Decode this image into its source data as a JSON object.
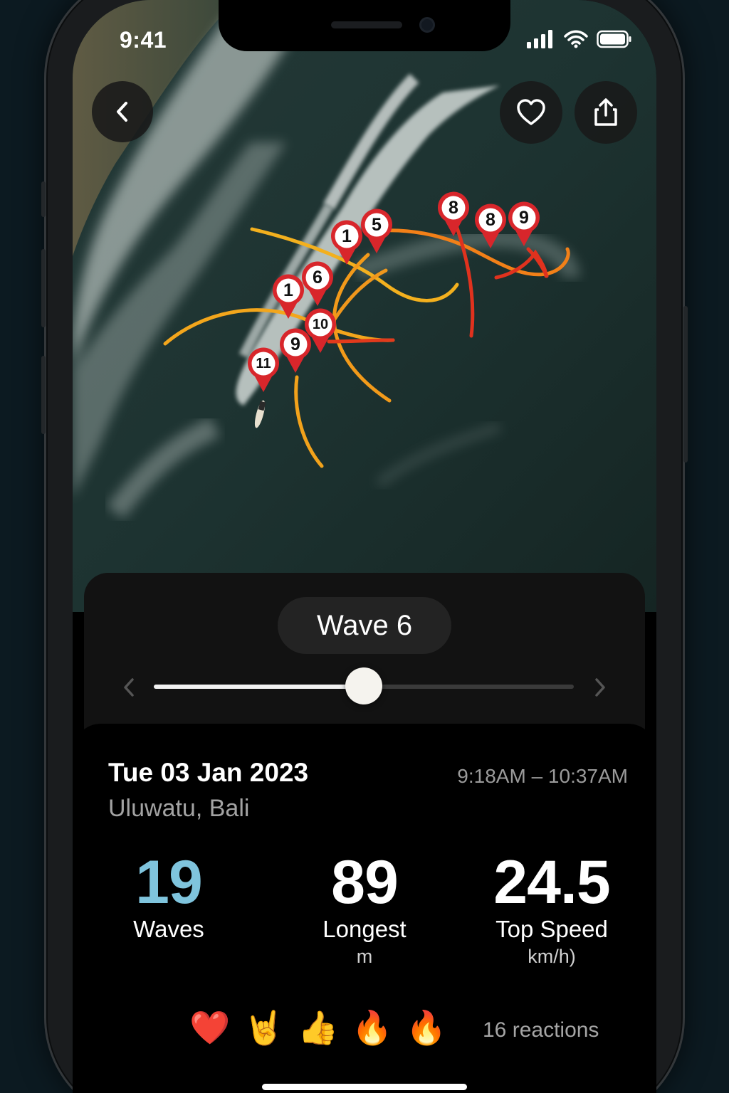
{
  "status_bar": {
    "time": "9:41"
  },
  "nav": {
    "back_icon": "chevron-left-icon",
    "favorite_icon": "heart-icon",
    "share_icon": "share-icon"
  },
  "map": {
    "markers": [
      "1",
      "5",
      "8",
      "8",
      "9",
      "1",
      "6",
      "10",
      "9",
      "11"
    ]
  },
  "wave_selector": {
    "label": "Wave 6",
    "position": 0.5
  },
  "session": {
    "date": "Tue 03 Jan 2023",
    "location": "Uluwatu, Bali",
    "time_range": "9:18AM – 10:37AM"
  },
  "stats": {
    "waves": {
      "value": "19",
      "label": "Waves",
      "color": "#7fc4dd"
    },
    "longest": {
      "value": "89",
      "label": "Longest",
      "unit": "m"
    },
    "top_speed": {
      "value": "24.5",
      "label": "Top Speed",
      "unit": "km/h)"
    }
  },
  "reactions": {
    "emojis": [
      "❤️",
      "🤘",
      "👍",
      "🔥",
      "🔥"
    ],
    "count_text": "16 reactions"
  },
  "colors": {
    "track_orange": "#f29a1a",
    "track_red": "#e0321e",
    "pin_red": "#d8262b"
  }
}
